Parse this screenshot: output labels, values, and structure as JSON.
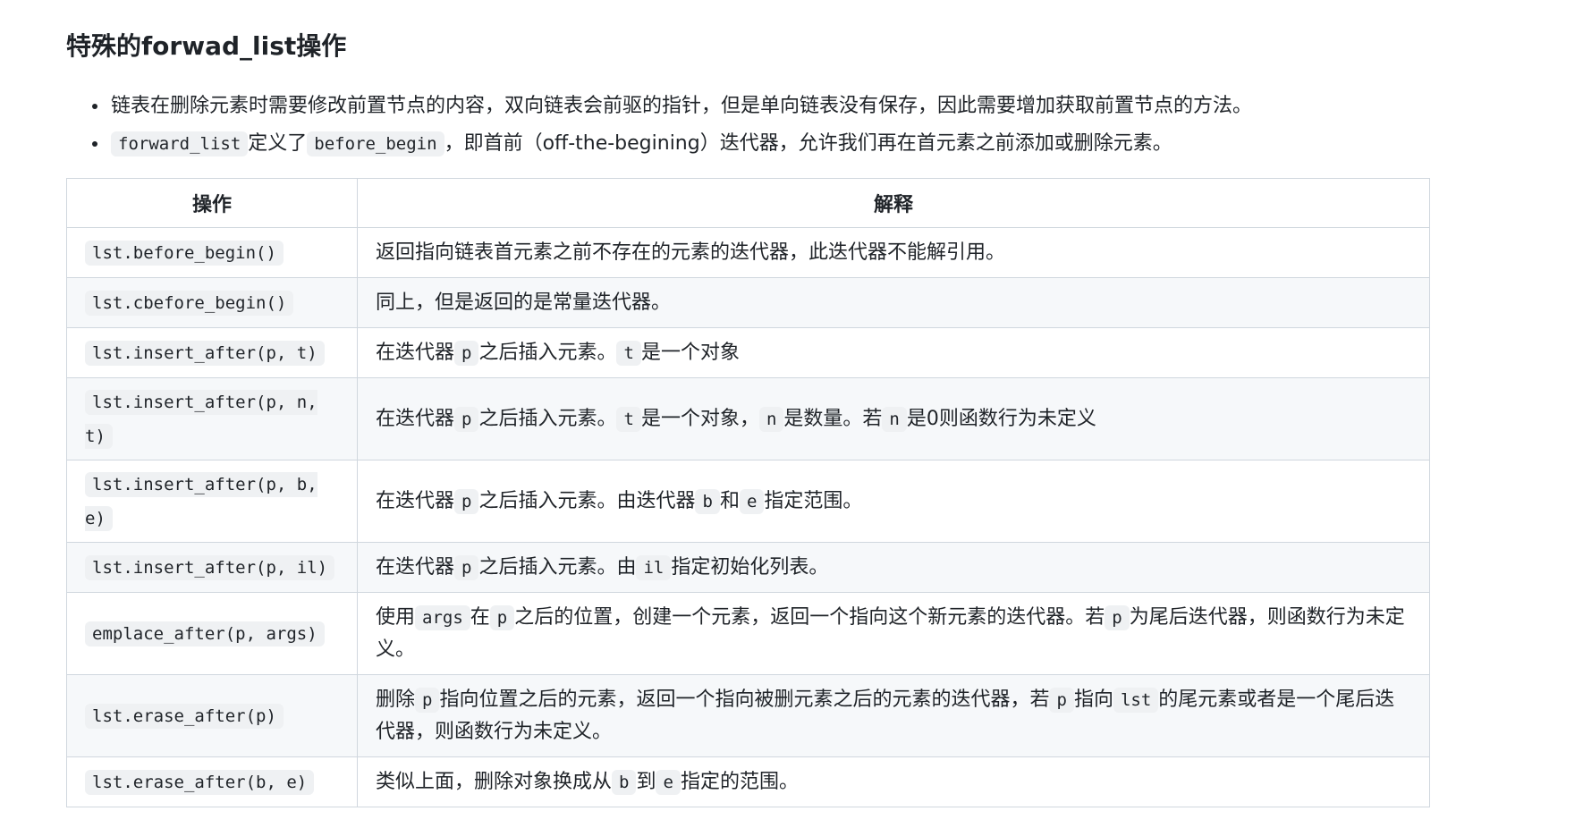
{
  "heading": "特殊的forwad_list操作",
  "notes": [
    {
      "parts": [
        {
          "t": "text",
          "v": "链表在删除元素时需要修改前置节点的内容，双向链表会前驱的指针，但是单向链表没有保存，因此需要增加获取前置节点的方法。"
        }
      ]
    },
    {
      "parts": [
        {
          "t": "code",
          "v": "forward_list"
        },
        {
          "t": "text",
          "v": "定义了"
        },
        {
          "t": "code",
          "v": "before_begin"
        },
        {
          "t": "text",
          "v": "，即首前（off-the-begining）迭代器，允许我们再在首元素之前添加或删除元素。"
        }
      ]
    }
  ],
  "table": {
    "headers": [
      "操作",
      "解释"
    ],
    "rows": [
      {
        "op": "lst.before_begin()",
        "desc": [
          {
            "t": "text",
            "v": "返回指向链表首元素之前不存在的元素的迭代器，此迭代器不能解引用。"
          }
        ]
      },
      {
        "op": "lst.cbefore_begin()",
        "desc": [
          {
            "t": "text",
            "v": "同上，但是返回的是常量迭代器。"
          }
        ]
      },
      {
        "op": "lst.insert_after(p, t)",
        "desc": [
          {
            "t": "text",
            "v": "在迭代器"
          },
          {
            "t": "code",
            "v": "p"
          },
          {
            "t": "text",
            "v": "之后插入元素。"
          },
          {
            "t": "code",
            "v": "t"
          },
          {
            "t": "text",
            "v": "是一个对象"
          }
        ]
      },
      {
        "op": "lst.insert_after(p, n, t)",
        "desc": [
          {
            "t": "text",
            "v": "在迭代器"
          },
          {
            "t": "code",
            "v": "p"
          },
          {
            "t": "text",
            "v": "之后插入元素。"
          },
          {
            "t": "code",
            "v": "t"
          },
          {
            "t": "text",
            "v": "是一个对象，"
          },
          {
            "t": "code",
            "v": "n"
          },
          {
            "t": "text",
            "v": "是数量。若"
          },
          {
            "t": "code",
            "v": "n"
          },
          {
            "t": "text",
            "v": "是0则函数行为未定义"
          }
        ]
      },
      {
        "op": "lst.insert_after(p, b, e)",
        "desc": [
          {
            "t": "text",
            "v": "在迭代器"
          },
          {
            "t": "code",
            "v": "p"
          },
          {
            "t": "text",
            "v": "之后插入元素。由迭代器"
          },
          {
            "t": "code",
            "v": "b"
          },
          {
            "t": "text",
            "v": "和"
          },
          {
            "t": "code",
            "v": "e"
          },
          {
            "t": "text",
            "v": "指定范围。"
          }
        ]
      },
      {
        "op": "lst.insert_after(p, il)",
        "desc": [
          {
            "t": "text",
            "v": "在迭代器"
          },
          {
            "t": "code",
            "v": "p"
          },
          {
            "t": "text",
            "v": "之后插入元素。由"
          },
          {
            "t": "code",
            "v": "il"
          },
          {
            "t": "text",
            "v": "指定初始化列表。"
          }
        ]
      },
      {
        "op": "emplace_after(p, args)",
        "desc": [
          {
            "t": "text",
            "v": "使用"
          },
          {
            "t": "code",
            "v": "args"
          },
          {
            "t": "text",
            "v": "在"
          },
          {
            "t": "code",
            "v": "p"
          },
          {
            "t": "text",
            "v": "之后的位置，创建一个元素，返回一个指向这个新元素的迭代器。若"
          },
          {
            "t": "code",
            "v": "p"
          },
          {
            "t": "text",
            "v": "为尾后迭代器，则函数行为未定义。"
          }
        ]
      },
      {
        "op": "lst.erase_after(p)",
        "desc": [
          {
            "t": "text",
            "v": "删除"
          },
          {
            "t": "code",
            "v": "p"
          },
          {
            "t": "text",
            "v": "指向位置之后的元素，返回一个指向被删元素之后的元素的迭代器，若"
          },
          {
            "t": "code",
            "v": "p"
          },
          {
            "t": "text",
            "v": "指向"
          },
          {
            "t": "code",
            "v": "lst"
          },
          {
            "t": "text",
            "v": "的尾元素或者是一个尾后迭代器，则函数行为未定义。"
          }
        ]
      },
      {
        "op": "lst.erase_after(b, e)",
        "desc": [
          {
            "t": "text",
            "v": "类似上面，删除对象换成从"
          },
          {
            "t": "code",
            "v": "b"
          },
          {
            "t": "text",
            "v": "到"
          },
          {
            "t": "code",
            "v": "e"
          },
          {
            "t": "text",
            "v": "指定的范围。"
          }
        ]
      }
    ]
  }
}
